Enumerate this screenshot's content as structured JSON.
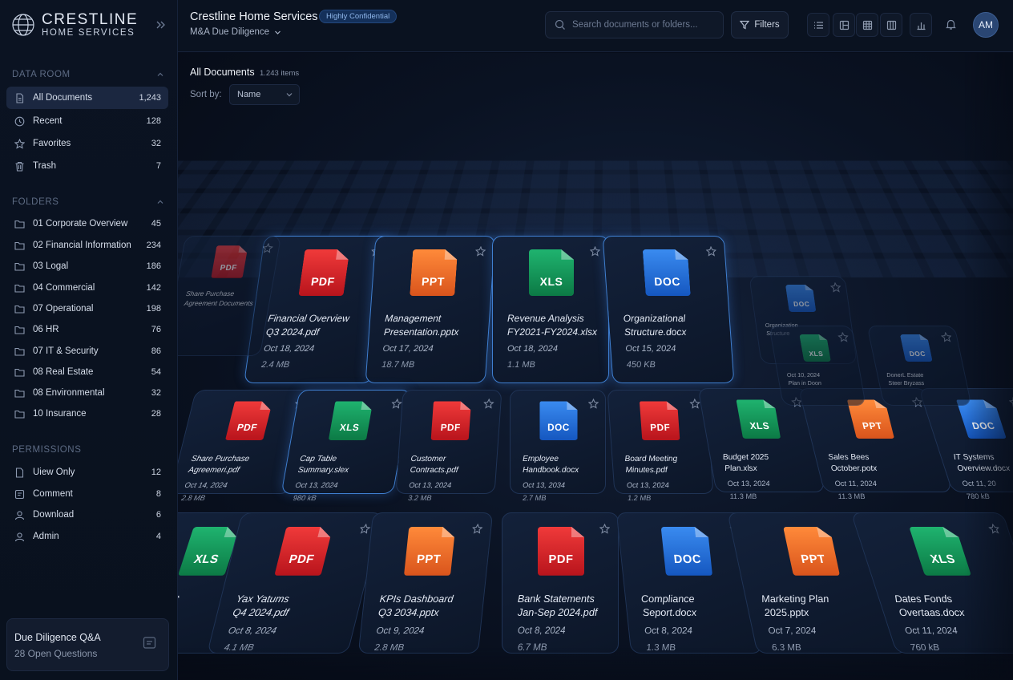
{
  "brand": {
    "name": "CRESTLINE",
    "sub": "HOME SERVICES"
  },
  "header": {
    "title": "Crestline Home Services",
    "badge": "Highly Confidential",
    "project": "M&A Due Diligence",
    "search_placeholder": "Search documents or folders...",
    "filters_label": "Filters",
    "avatar_initials": "AM"
  },
  "sidebar": {
    "data_room_title": "DATA ROOM",
    "data_room": [
      {
        "label": "All Documents",
        "count": "1,243",
        "icon": "file-icon"
      },
      {
        "label": "Recent",
        "count": "128",
        "icon": "clock-icon"
      },
      {
        "label": "Favorites",
        "count": "32",
        "icon": "star-icon"
      },
      {
        "label": "Trash",
        "count": "7",
        "icon": "trash-icon"
      }
    ],
    "folders_title": "FOLDERS",
    "folders": [
      {
        "label": "01 Corporate Overview",
        "count": "45"
      },
      {
        "label": "02 Financial Information",
        "count": "234"
      },
      {
        "label": "03 Logal",
        "count": "186"
      },
      {
        "label": "04 Commercial",
        "count": "142"
      },
      {
        "label": "07 Operational",
        "count": "198"
      },
      {
        "label": "06 HR",
        "count": "76"
      },
      {
        "label": "07 IT & Security",
        "count": "86"
      },
      {
        "label": "08 Real Estate",
        "count": "54"
      },
      {
        "label": "08 Environmental",
        "count": "32"
      },
      {
        "label": "10 Insurance",
        "count": "28"
      }
    ],
    "permissions_title": "PERMISSIONS",
    "permissions": [
      {
        "label": "Uiew Only",
        "count": "12"
      },
      {
        "label": "Comment",
        "count": "8"
      },
      {
        "label": "Download",
        "count": "6"
      },
      {
        "label": "Admin",
        "count": "4"
      }
    ],
    "qa": {
      "title": "Due Diligence Q&A",
      "sub": "28 Open Questions"
    }
  },
  "main": {
    "title": "All Documents",
    "count": "1.243 items",
    "sort_label": "Sort by:",
    "sort_value": "Name"
  },
  "files": {
    "row1": [
      {
        "type": "pdf",
        "tag": "PDF",
        "name1": "Financial Overview",
        "name2": "Q3 2024.pdf",
        "date": "Oct 18, 2024",
        "size": "2.4 MB"
      },
      {
        "type": "ppt",
        "tag": "PPT",
        "name1": "Management",
        "name2": "Presentation.pptx",
        "date": "Oct 17, 2024",
        "size": "18.7 MB"
      },
      {
        "type": "xls",
        "tag": "XLS",
        "name1": "Revenue Analysis",
        "name2": "FY2021-FY2024.xlsx",
        "date": "Oct 18, 2024",
        "size": "1.1 MB"
      },
      {
        "type": "doc",
        "tag": "DOC",
        "name1": "Organizational",
        "name2": "Structure.docx",
        "date": "Oct 15, 2024",
        "size": "450 KB"
      }
    ],
    "row2": [
      {
        "type": "pdf",
        "tag": "PDF",
        "name1": "Share Purchase",
        "name2": "Agreemeri.pdf",
        "date": "Oct 14, 2024",
        "size": "2.8 MB"
      },
      {
        "type": "xls",
        "tag": "XLS",
        "name1": "Cap Table",
        "name2": "Summary.slex",
        "date": "Oct 13, 2024",
        "size": "980 kB"
      },
      {
        "type": "pdf",
        "tag": "PDF",
        "name1": "Customer",
        "name2": "Contracts.pdf",
        "date": "Oct 13, 2024",
        "size": "3.2 MB"
      },
      {
        "type": "doc",
        "tag": "DOC",
        "name1": "Employee",
        "name2": "Handbook.docx",
        "date": "Oct 13, 2034",
        "size": "2.7 MB"
      },
      {
        "type": "pdf",
        "tag": "PDF",
        "name1": "Board Meeting",
        "name2": "Minutes.pdf",
        "date": "Oct 13, 2024",
        "size": "1.2 MB"
      },
      {
        "type": "xls",
        "tag": "XLS",
        "name1": "Budget 2025",
        "name2": "Plan.xlsx",
        "date": "Oct 13, 2024",
        "size": "11.3 MB"
      },
      {
        "type": "ppt",
        "tag": "PPT",
        "name1": "Sales Bees",
        "name2": "October.potx",
        "date": "Oct 11, 2024",
        "size": "11.3 MB"
      },
      {
        "type": "doc",
        "tag": "DOC",
        "name1": "IT Systems",
        "name2": "Overview.docx",
        "date": "Oct 11, 20",
        "size": "780 kB"
      }
    ],
    "row3": [
      {
        "type": "xls",
        "tag": "XLS",
        "name1": "r List",
        "name2": "xlsx",
        "date": "",
        "size": ""
      },
      {
        "type": "pdf",
        "tag": "PDF",
        "name1": "Yax Yatums",
        "name2": "Q4 2024.pdf",
        "date": "Oct 8, 2024",
        "size": "4.1 MB"
      },
      {
        "type": "ppt",
        "tag": "PPT",
        "name1": "KPIs Dashboard",
        "name2": "Q3 2034.pptx",
        "date": "Oct 9, 2024",
        "size": "2.8 MB"
      },
      {
        "type": "pdf",
        "tag": "PDF",
        "name1": "Bank Statements",
        "name2": "Jan-Sep 2024.pdf",
        "date": "Oct 8, 2024",
        "size": "6.7 MB"
      },
      {
        "type": "doc",
        "tag": "DOC",
        "name1": "Compliance",
        "name2": "Seport.docx",
        "date": "Oct 8, 2024",
        "size": "1.3 MB"
      },
      {
        "type": "ppt",
        "tag": "PPT",
        "name1": "Marketing Plan",
        "name2": "2025.pptx",
        "date": "Oct 7, 2024",
        "size": "6.3 MB"
      },
      {
        "type": "xls",
        "tag": "XLS",
        "name1": "Dates Fonds",
        "name2": "Overtaas.docx",
        "date": "Oct 11, 2024",
        "size": "760 kB"
      }
    ],
    "side": [
      {
        "type": "pdf",
        "tag": "PDF",
        "name1": "Share Purchase",
        "name2": "Agreement Documents",
        "date": "",
        "size": ""
      },
      {
        "type": "doc",
        "tag": "DOC",
        "name1": "Organization",
        "name2": "Structure",
        "date": "",
        "size": ""
      },
      {
        "type": "xls",
        "tag": "XLS",
        "name1": "Oct 10, 2024",
        "name2": "Plan in Doon",
        "date": "",
        "size": ""
      },
      {
        "type": "doc",
        "tag": "DOC",
        "name1": "DonerL Estate",
        "name2": "Steer Bryzass",
        "date": "",
        "size": ""
      }
    ]
  },
  "colors": {
    "accent": "#3f7fd0",
    "pdf": "#e0262e",
    "ppt": "#f06a2a",
    "xls": "#16975a",
    "doc": "#2b74df"
  }
}
